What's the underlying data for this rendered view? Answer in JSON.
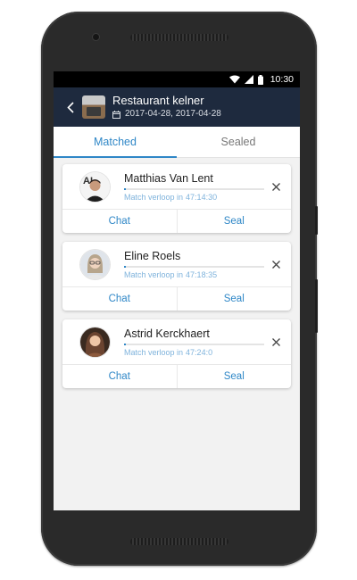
{
  "status_bar": {
    "time": "10:30",
    "icons": [
      "wifi-icon",
      "signal-icon",
      "battery-icon"
    ]
  },
  "header": {
    "title": "Restaurant kelner",
    "dates": "2017-04-28, 2017-04-28",
    "back_icon": "back-chevron-icon",
    "calendar_icon": "calendar-icon"
  },
  "tabs": [
    {
      "label": "Matched",
      "active": true
    },
    {
      "label": "Sealed",
      "active": false
    }
  ],
  "candidates": [
    {
      "name": "Matthias Van Lent",
      "expiry_label": "Match verloop in",
      "expiry_time": "47:14:30",
      "progress": 0.01,
      "chat_label": "Chat",
      "seal_label": "Seal"
    },
    {
      "name": "Eline Roels",
      "expiry_label": "Match verloop in",
      "expiry_time": "47:18:35",
      "progress": 0.01,
      "chat_label": "Chat",
      "seal_label": "Seal"
    },
    {
      "name": "Astrid Kerckhaert",
      "expiry_label": "Match verloop in",
      "expiry_time": "47:24:0",
      "progress": 0.01,
      "chat_label": "Chat",
      "seal_label": "Seal"
    }
  ],
  "colors": {
    "accent": "#2f87c7",
    "header_bg": "#1e2a3e",
    "screen_bg": "#f2f2f2"
  }
}
